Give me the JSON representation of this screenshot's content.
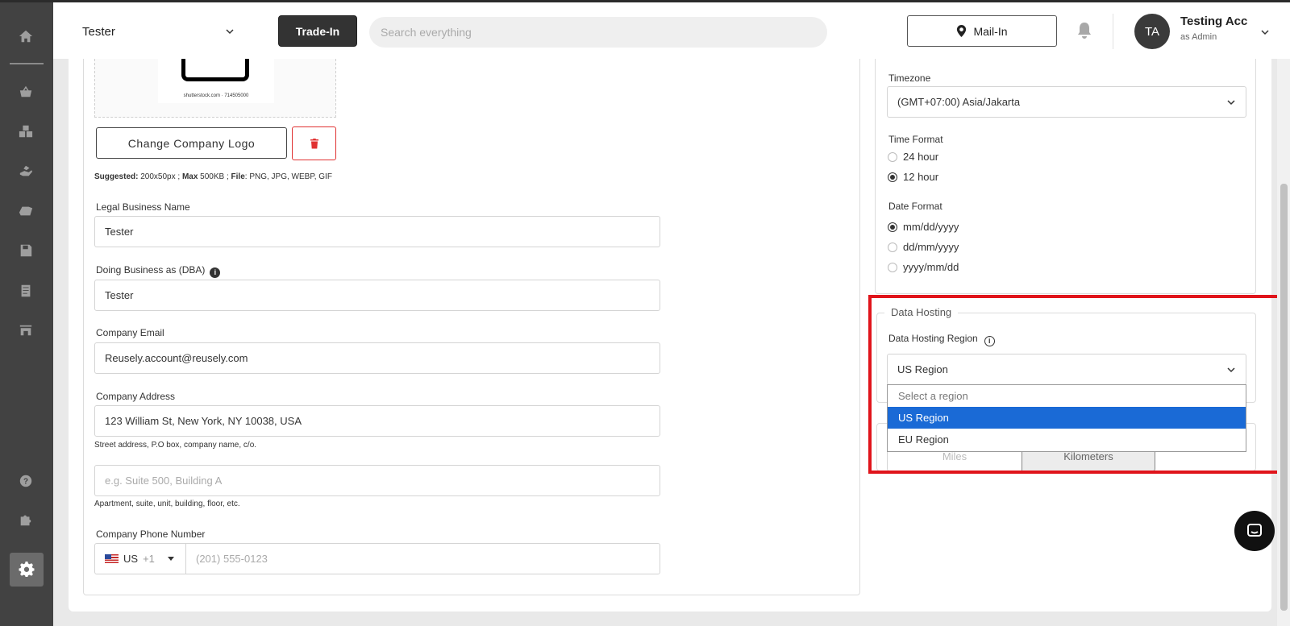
{
  "header": {
    "company": "Tester",
    "trade_in_label": "Trade-In",
    "search_placeholder": "Search everything",
    "mail_in_label": "Mail-In",
    "avatar_initials": "TA",
    "user_name": "Testing Acc",
    "user_role": "as Admin"
  },
  "sidebar": {
    "items": [
      "home-icon",
      "basket-icon",
      "boxes-icon",
      "hand-icon",
      "truck-icon",
      "save-icon",
      "document-icon",
      "store-icon",
      "help-icon",
      "puzzle-icon",
      "gear-icon"
    ],
    "active": "gear-icon"
  },
  "logo": {
    "caption": "shutterstock.com · 714505000",
    "change_label": "Change Company Logo",
    "hint_suggested_label": "Suggested:",
    "hint_suggested_value": " 200x50px ; ",
    "hint_max_label": "Max",
    "hint_max_value": " 500KB ; ",
    "hint_file_label": "File",
    "hint_file_value": ": PNG, JPG, WEBP, GIF"
  },
  "form": {
    "legal_name_label": "Legal Business Name",
    "legal_name_value": "Tester",
    "dba_label": "Doing Business as (DBA)",
    "dba_value": "Tester",
    "email_label": "Company Email",
    "email_value": "Reusely.account@reusely.com",
    "address_label": "Company Address",
    "address_value": "123 William St, New York, NY 10038, USA",
    "address_hint": "Street address, P.O box, company name, c/o.",
    "address2_placeholder": "e.g. Suite 500, Building A",
    "address2_hint": "Apartment, suite, unit, building, floor, etc.",
    "phone_label": "Company Phone Number",
    "phone_country": "US",
    "phone_code": "+1",
    "phone_placeholder": "(201) 555-0123"
  },
  "settings": {
    "timezone_label": "Timezone",
    "timezone_value": "(GMT+07:00) Asia/Jakarta",
    "time_format_label": "Time Format",
    "time_format_options": [
      "24 hour",
      "12 hour"
    ],
    "time_format_selected": "12 hour",
    "date_format_label": "Date Format",
    "date_format_options": [
      "mm/dd/yyyy",
      "dd/mm/yyyy",
      "yyyy/mm/dd"
    ],
    "date_format_selected": "mm/dd/yyyy"
  },
  "data_hosting": {
    "legend": "Data Hosting",
    "region_label": "Data Hosting Region",
    "region_value": "US Region",
    "options": [
      "Select a region",
      "US Region",
      "EU Region"
    ],
    "highlighted_option": "US Region"
  },
  "units": {
    "miles": "Miles",
    "kilometers": "Kilometers"
  },
  "colors": {
    "highlight_border": "#e0141b",
    "dropdown_selected": "#1a6ad6",
    "delete_red": "#e03131"
  }
}
